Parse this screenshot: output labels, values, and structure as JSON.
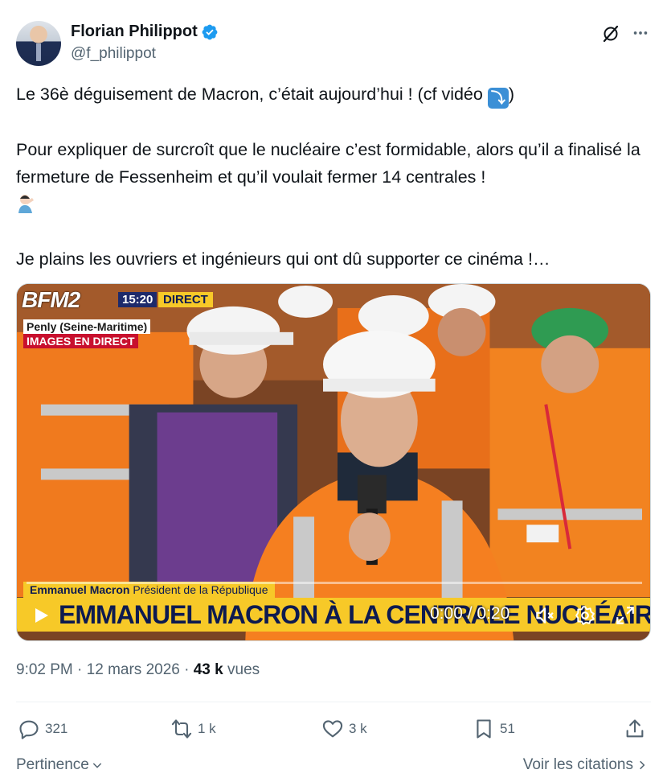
{
  "author": {
    "name": "Florian Philippot",
    "handle": "@f_philippot"
  },
  "tweet": {
    "line1": "Le 36è déguisement de Macron, c’était aujourd’hui ! (cf vidéo",
    "line1_end": ")",
    "paragraph2": "Pour expliquer de surcroît que le nucléaire c’est formidable, alors qu’il a finalisé la fermeture de Fessenheim et qu’il voulait fermer 14 centrales !",
    "paragraph3": "Je plains les ouvriers et ingénieurs qui ont dû supporter ce cinéma !…",
    "emoji_arrow": "⤵",
    "emoji_facepalm": "facepalm-emoji"
  },
  "video": {
    "channel_logo": "BFM2",
    "channel_time": "15:20",
    "channel_live": "DIRECT",
    "location": "Penly (Seine-Maritime)",
    "live_label": "IMAGES EN DIRECT",
    "speaker_name": "Emmanuel Macron",
    "speaker_title": "Président de la République",
    "headline": "EMMANUEL MACRON À LA CENTRALE NUCLÉAIRE DE PENLY",
    "timecode": "0:00 / 0:20",
    "progress": 0
  },
  "meta": {
    "time": "9:02 PM",
    "separator": "·",
    "date": "12 mars 2026",
    "views_count": "43 k",
    "views_label": "vues"
  },
  "actions": {
    "replies": "321",
    "reposts": "1 k",
    "likes": "3 k",
    "bookmarks": "51"
  },
  "footer": {
    "sort_label": "Pertinence",
    "quotes_label": "Voir les citations"
  },
  "colors": {
    "verified": "#1d9bf0",
    "text": "#0f1419",
    "secondary": "#536471",
    "bfm_yellow": "#f7c928"
  }
}
